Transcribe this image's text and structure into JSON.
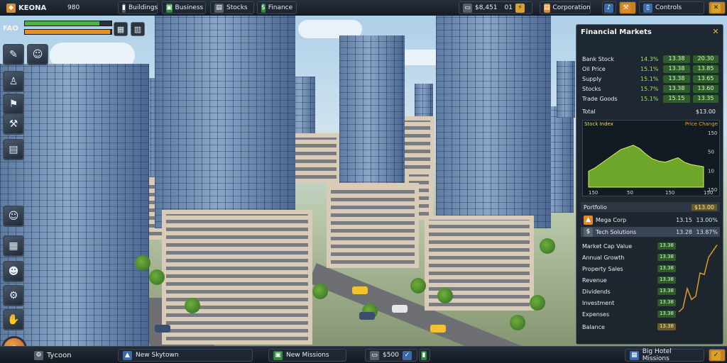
{
  "topbar": {
    "logo": "KEONA",
    "logo_value": "980",
    "tabs": [
      "Buildings",
      "Business",
      "Stocks",
      "Finance"
    ],
    "money": "$8,451",
    "time": "01",
    "company": "Corporation",
    "settings": "Controls"
  },
  "hud": {
    "bar_label": "FAO",
    "bar_green_fraction": 0.86,
    "bar_orange_fraction": 0.98
  },
  "panel": {
    "title": "Financial Markets",
    "resources": [
      {
        "name": "Bank Stock",
        "pct": "14.3%",
        "val": "13.38",
        "val2": "20.30"
      },
      {
        "name": "Oil Price",
        "pct": "15.1%",
        "val": "13.38",
        "val2": "13.85"
      },
      {
        "name": "Supply",
        "pct": "15.1%",
        "val": "13.38",
        "val2": "13.65"
      },
      {
        "name": "Stocks",
        "pct": "15.7%",
        "val": "13.38",
        "val2": "13.60"
      },
      {
        "name": "Trade Goods",
        "pct": "15.1%",
        "val": "15.15",
        "val2": "13.35"
      }
    ],
    "summary_left": "Total",
    "summary_right": "$13.00",
    "chart_title": "Stock Index",
    "chart_subtitle": "Price Change",
    "list_header": "Portfolio",
    "list_header_value": "$13.00",
    "list": [
      {
        "name": "Mega Corp",
        "v1": "13.15",
        "v2": "13.00%"
      },
      {
        "name": "Tech Solutions",
        "v1": "13.28",
        "v2": "13.87%"
      }
    ],
    "stats": [
      {
        "name": "Market Cap Value",
        "val": "13.38"
      },
      {
        "name": "Annual Growth",
        "val": "13.38"
      },
      {
        "name": "Property Sales",
        "val": "13.38"
      },
      {
        "name": "Revenue",
        "val": "13.38"
      },
      {
        "name": "Dividends",
        "val": "13.38"
      },
      {
        "name": "Investment",
        "val": "13.38"
      },
      {
        "name": "Expenses",
        "val": "13.38"
      },
      {
        "name": "Balance",
        "val": "13.38"
      }
    ]
  },
  "chart_data": {
    "type": "area",
    "title": "Stock Index",
    "subtitle": "Price Change",
    "x": [
      0,
      1,
      2,
      3,
      4,
      5,
      6,
      7,
      8,
      9,
      10,
      11,
      12,
      13,
      14,
      15,
      16,
      17,
      18
    ],
    "values": [
      28,
      34,
      42,
      50,
      58,
      66,
      70,
      74,
      68,
      58,
      50,
      46,
      44,
      48,
      52,
      44,
      40,
      38,
      36
    ],
    "xticks": [
      "150",
      "50",
      "150",
      "150"
    ],
    "yticks": [
      "150",
      "50",
      "10",
      "150"
    ],
    "ylim": [
      0,
      100
    ],
    "color": "#7fbf2a"
  },
  "stats_chart": {
    "values": [
      10,
      15,
      40,
      26,
      30,
      60,
      58,
      80,
      88,
      96
    ],
    "color": "#e09a2a"
  },
  "bottombar": {
    "tycoon": "Tycoon",
    "city": "New Skytown",
    "mission": "New Missions",
    "money_label": "$500",
    "right_label": "Big Hotel Missions"
  }
}
